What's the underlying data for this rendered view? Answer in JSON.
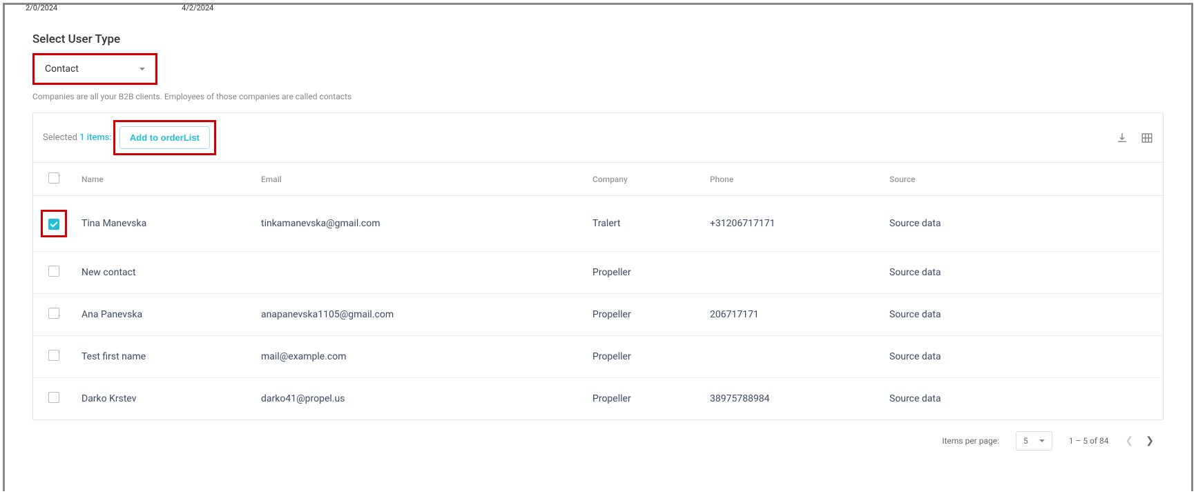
{
  "header_dates": {
    "d1": "2/0/2024",
    "d2": "4/2/2024"
  },
  "title": "Select User Type",
  "user_type_select": {
    "value": "Contact"
  },
  "helper": "Companies are all your B2B clients. Employees of those companies are called contacts",
  "toolbar": {
    "selected_prefix": "Selected ",
    "selected_count": "1 items:",
    "add_button": "Add to orderList"
  },
  "columns": {
    "name": "Name",
    "email": "Email",
    "company": "Company",
    "phone": "Phone",
    "source": "Source"
  },
  "rows": [
    {
      "checked": true,
      "name": "Tina Manevska",
      "email": "tinkamanevska@gmail.com",
      "company": "Tralert",
      "phone": "+31206717171",
      "source": "Source data"
    },
    {
      "checked": false,
      "name": "New contact",
      "email": "",
      "company": "Propeller",
      "phone": "",
      "source": "Source data"
    },
    {
      "checked": false,
      "name": "Ana Panevska",
      "email": "anapanevska1105@gmail.com",
      "company": "Propeller",
      "phone": "206717171",
      "source": "Source data"
    },
    {
      "checked": false,
      "name": "Test first name",
      "email": "mail@example.com",
      "company": "Propeller",
      "phone": "",
      "source": "Source data"
    },
    {
      "checked": false,
      "name": "Darko Krstev",
      "email": "darko41@propel.us",
      "company": "Propeller",
      "phone": "38975788984",
      "source": "Source data"
    }
  ],
  "paginator": {
    "items_per_page_label": "Items per page:",
    "items_per_page_value": "5",
    "range": "1 – 5 of 84"
  }
}
